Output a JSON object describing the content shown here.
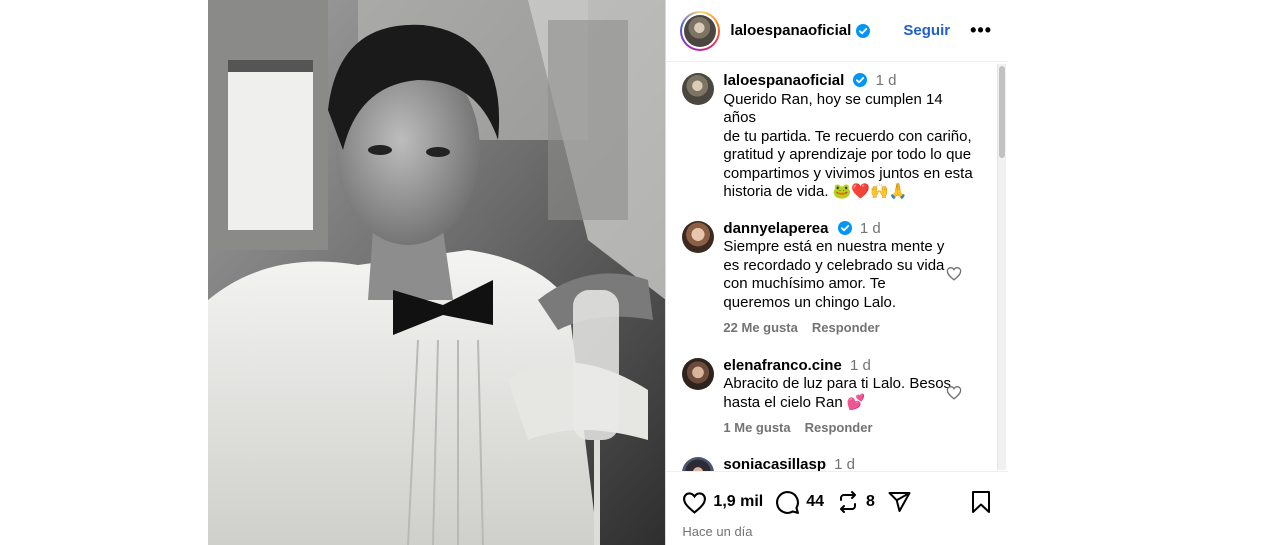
{
  "header": {
    "username": "laloespanaoficial",
    "follow_label": "Seguir",
    "more_label": "•••"
  },
  "caption": {
    "username": "laloespanaoficial",
    "time": "1 d",
    "text": "Querido Ran, hoy se cumplen 14 años\nde tu partida. Te recuerdo con cariño,\ngratitud y aprendizaje por todo lo que\ncompartimos y vivimos juntos en esta\nhistoria de vida. 🐸❤️🙌🙏"
  },
  "comments": [
    {
      "username": "dannyelaperea",
      "verified": true,
      "time": "1 d",
      "text": "Siempre está en nuestra mente y\nes recordado y celebrado su vida\ncon muchísimo amor. Te\nqueremos un chingo Lalo.",
      "likes": "22 Me gusta",
      "reply": "Responder"
    },
    {
      "username": "elenafranco.cine",
      "verified": false,
      "time": "1 d",
      "text": "Abracito de luz para ti Lalo. Besos\nhasta el cielo Ran 💕",
      "likes": "1 Me gusta",
      "reply": "Responder"
    },
    {
      "username": "soniacasillasp",
      "verified": false,
      "time": "1 d",
      "text": "",
      "likes": "",
      "reply": ""
    }
  ],
  "actions": {
    "like_count": "1,9 mil",
    "comment_count": "44",
    "repost_count": "8"
  },
  "timestamp": "Hace un día",
  "colors": {
    "verified": "#0095f6",
    "follow": "#1f5fd6",
    "muted": "#737373"
  }
}
